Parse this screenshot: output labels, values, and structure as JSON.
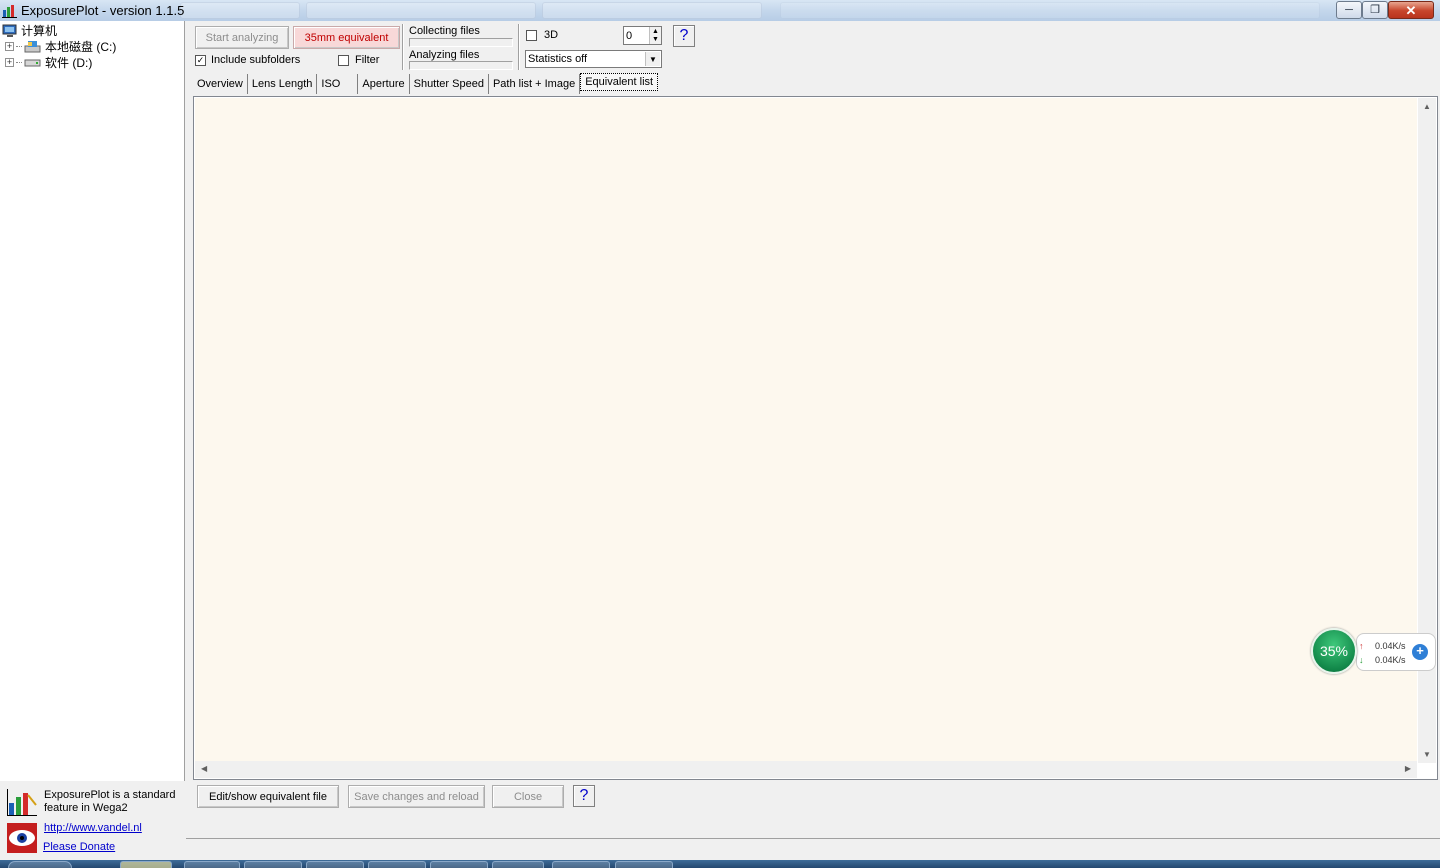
{
  "window": {
    "title": "ExposurePlot - version 1.1.5"
  },
  "tree": {
    "root": "计算机",
    "drives": [
      {
        "label": "本地磁盘 (C:)"
      },
      {
        "label": "软件 (D:)"
      }
    ]
  },
  "toolbar": {
    "start_label": "Start analyzing",
    "equiv_label": "35mm equivalent",
    "include_subfolders_label": "Include subfolders",
    "include_subfolders_checked": true,
    "filter_label": "Filter",
    "filter_checked": false,
    "collecting_label": "Collecting files",
    "analyzing_label": "Analyzing files",
    "threeD_label": "3D",
    "threeD_checked": false,
    "spin_value": "0",
    "statistics_value": "Statistics off",
    "help_label": "?"
  },
  "tabs": [
    {
      "label": "Overview"
    },
    {
      "label": "Lens Length"
    },
    {
      "label": "ISO"
    },
    {
      "label": "Aperture"
    },
    {
      "label": "Shutter Speed"
    },
    {
      "label": "Path list + Image"
    },
    {
      "label": "Equivalent list",
      "active": true
    }
  ],
  "bottom_buttons": {
    "edit_label": "Edit/show equivalent file",
    "save_label": "Save changes and reload",
    "close_label": "Close",
    "help_label": "?"
  },
  "promo": {
    "text": "ExposurePlot is a standard feature in Wega2",
    "link": "http://www.vandel.nl",
    "donate": "Please Donate"
  },
  "net_widget": {
    "percent": "35%",
    "up_rate": "0.04K/s",
    "down_rate": "0.04K/s"
  },
  "colors": {
    "content_bg": "#fdf8ee",
    "equiv_button_bg": "#f8d8d8",
    "equiv_button_text": "#c00000",
    "link": "#0000cc"
  }
}
